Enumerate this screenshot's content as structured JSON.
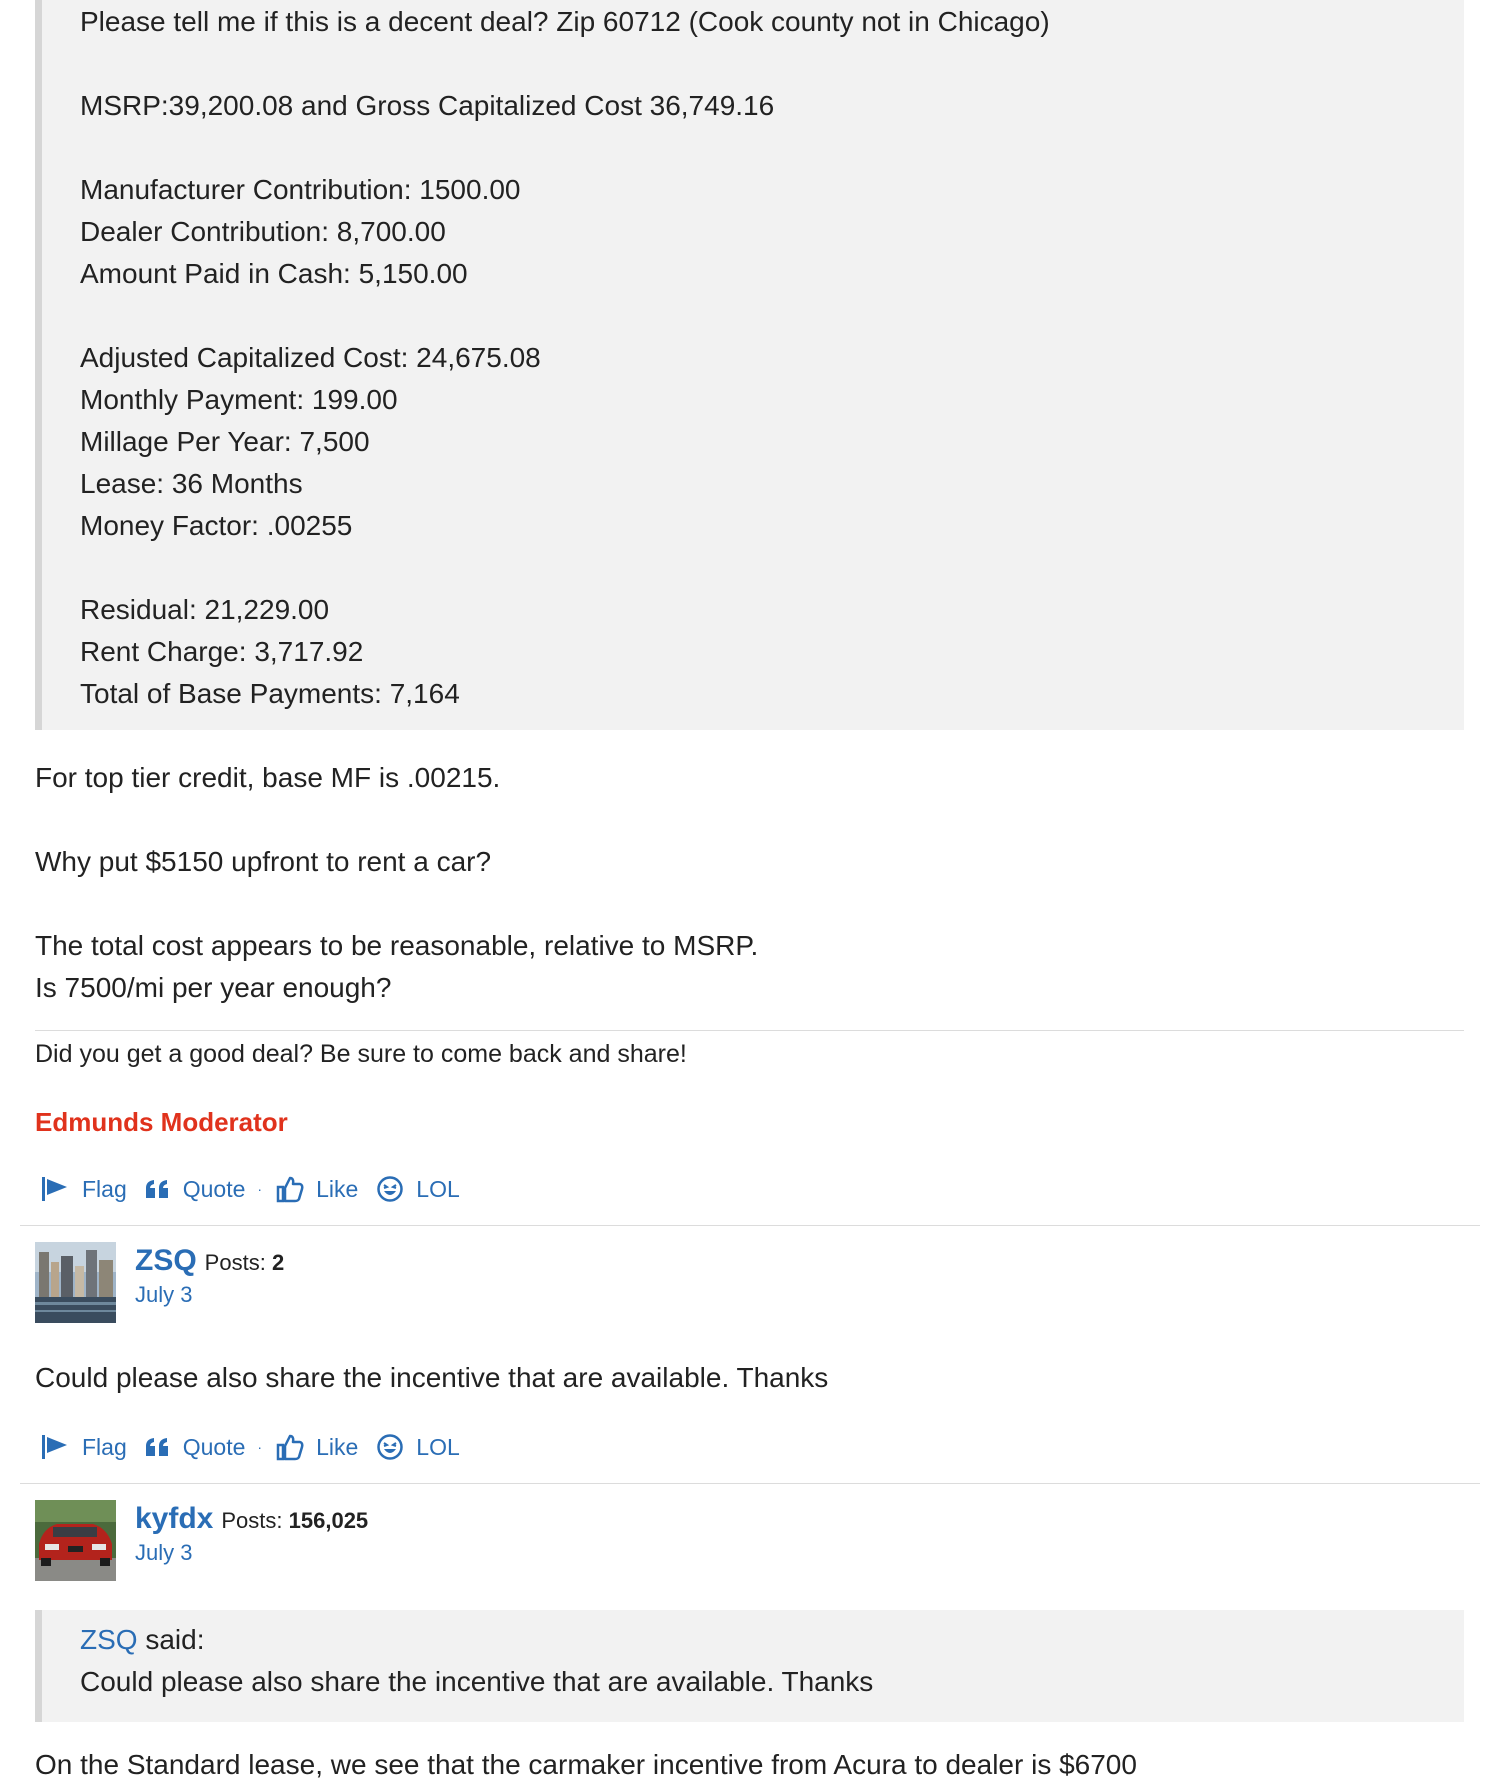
{
  "first_post": {
    "quoted_lines": [
      "Please tell me if this is a decent deal? Zip 60712 (Cook county not in Chicago)",
      "MSRP:39,200.08 and Gross Capitalized Cost 36,749.16",
      "Manufacturer Contribution: 1500.00",
      "Dealer Contribution: 8,700.00",
      "Amount Paid in Cash: 5,150.00",
      "Adjusted Capitalized Cost: 24,675.08",
      "Monthly Payment: 199.00",
      "Millage Per Year: 7,500",
      "Lease: 36 Months",
      "Money Factor: .00255",
      "Residual: 21,229.00",
      "Rent Charge: 3,717.92",
      "Total of Base Payments: 7,164"
    ],
    "body_lines": [
      "For top tier credit, base MF is .00215.",
      "Why put $5150 upfront to rent a car?",
      "The total cost appears to be reasonable, relative to MSRP.",
      "Is 7500/mi per year enough?"
    ],
    "signature": "Did you get a good deal? Be sure to come back and share!",
    "role": "Edmunds Moderator"
  },
  "actions": {
    "flag": "Flag",
    "quote": "Quote",
    "separator": "·",
    "like": "Like",
    "lol": "LOL"
  },
  "second_post": {
    "username": "ZSQ",
    "posts_label": "Posts:",
    "posts_count": "2",
    "date": "July 3",
    "body": "Could please also share the incentive that are available. Thanks"
  },
  "third_post": {
    "username": "kyfdx",
    "posts_label": "Posts:",
    "posts_count": "156,025",
    "date": "July 3",
    "quote_author": "ZSQ",
    "quote_said": " said:",
    "quote_text": "Could please also share the incentive that are available. Thanks",
    "body_partial": "On the Standard lease, we see that the carmaker incentive from Acura to dealer is $6700"
  },
  "colors": {
    "link": "#2a6db5",
    "moderator": "#e0321c",
    "quote_bg": "#f2f2f2"
  }
}
